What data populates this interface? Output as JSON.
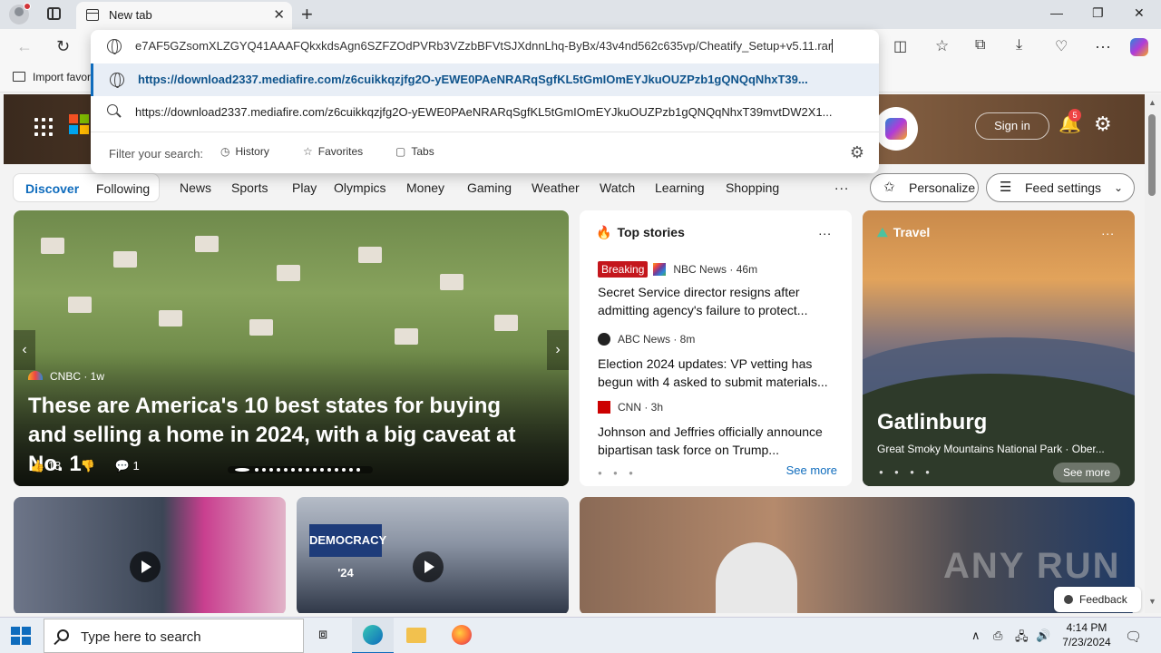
{
  "browser": {
    "tab_title": "New tab",
    "address_text": "e7AF5GZsomXLZGYQ41AAAFQkxkdsAgn6SZFZOdPVRb3VZzbBFVtSJXdnnLhq-ByBx/43v4nd562c635vp/Cheatify_Setup+v5.11.rar",
    "favorites_import": "Import favorites",
    "suggestions": [
      "https://download2337.mediafire.com/z6cuikkqzjfg2O-yEWE0PAeNRARqSgfKL5tGmIOmEYJkuOUZPzb1gQNQqNhxT39...",
      "https://download2337.mediafire.com/z6cuikkqzjfg2O-yEWE0PAeNRARqSgfKL5tGmIOmEYJkuOUZPzb1gQNQqNhxT39mvtDW2X1..."
    ],
    "filter_label": "Filter your search:",
    "filters": [
      "History",
      "Favorites",
      "Tabs"
    ]
  },
  "page": {
    "sign_in": "Sign in",
    "notification_count": "5",
    "nav_pill": [
      "Discover",
      "Following"
    ],
    "nav_items": [
      "News",
      "Sports",
      "Play",
      "Olympics",
      "Money",
      "Gaming",
      "Weather",
      "Watch",
      "Learning",
      "Shopping"
    ],
    "nav_more": "...",
    "personalize": "Personalize",
    "feed_settings": "Feed settings",
    "main_story": {
      "source": "CNBC · 1w",
      "headline": "These are America's 10 best states for buying and selling a home in 2024, with a big caveat at No. 1",
      "likes": "18",
      "comments": "1"
    },
    "top_stories": {
      "title": "Top stories",
      "more": "...",
      "items": [
        {
          "badge": "Breaking",
          "source": "NBC News · 46m",
          "title": "Secret Service director resigns after admitting agency's failure to protect..."
        },
        {
          "source": "ABC News · 8m",
          "title": "Election 2024 updates: VP vetting has begun with 4 asked to submit materials..."
        },
        {
          "source": "CNN · 3h",
          "title": "Johnson and Jeffries officially announce bipartisan task force on Trump..."
        }
      ],
      "see_more": "See more"
    },
    "travel": {
      "label": "Travel",
      "more": "...",
      "name": "Gatlinburg",
      "subtitle": "Great Smoky Mountains National Park · Ober...",
      "see_more": "See more"
    },
    "video2_banner": "DEMOCRACY '24",
    "feedback": "Feedback",
    "watermark": "ANY RUN"
  },
  "taskbar": {
    "search_placeholder": "Type here to search",
    "time": "4:14 PM",
    "date": "7/23/2024"
  },
  "colors": {
    "accent": "#0f6cbd",
    "breaking": "#c4161c"
  }
}
